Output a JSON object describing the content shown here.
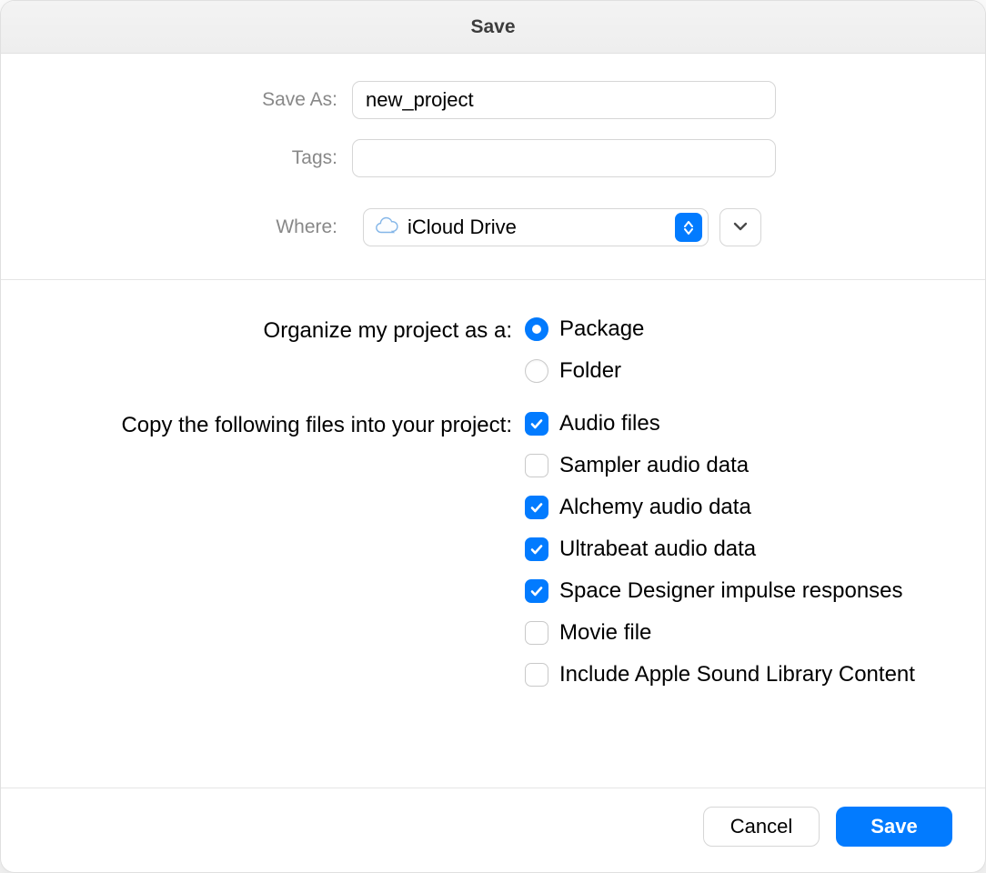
{
  "title": "Save",
  "labels": {
    "save_as": "Save As:",
    "tags": "Tags:",
    "where": "Where:"
  },
  "fields": {
    "save_as_value": "new_project",
    "tags_value": "",
    "where_value": "iCloud Drive"
  },
  "organize": {
    "label": "Organize my project as a:",
    "options": [
      {
        "label": "Package",
        "selected": true
      },
      {
        "label": "Folder",
        "selected": false
      }
    ]
  },
  "copy": {
    "label": "Copy the following files into your project:",
    "items": [
      {
        "label": "Audio files",
        "checked": true
      },
      {
        "label": "Sampler audio data",
        "checked": false
      },
      {
        "label": "Alchemy audio data",
        "checked": true
      },
      {
        "label": "Ultrabeat audio data",
        "checked": true
      },
      {
        "label": "Space Designer impulse responses",
        "checked": true
      },
      {
        "label": "Movie file",
        "checked": false
      },
      {
        "label": "Include Apple Sound Library Content",
        "checked": false
      }
    ]
  },
  "buttons": {
    "cancel": "Cancel",
    "save": "Save"
  }
}
